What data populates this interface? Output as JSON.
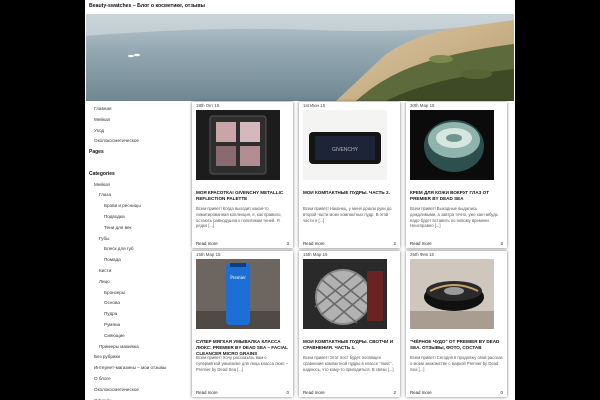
{
  "site": {
    "title": "Beauty-swatches – Блог о косметике, отзывы"
  },
  "sidebar": {
    "items": [
      {
        "label": "Главная",
        "level": 1,
        "heading": false
      },
      {
        "label": "Мейкап",
        "level": 1,
        "heading": false
      },
      {
        "label": "Уход",
        "level": 1,
        "heading": false
      },
      {
        "label": "Околокосметическое",
        "level": 1,
        "heading": false
      },
      {
        "label": "Pages",
        "level": 0,
        "heading": true
      },
      {
        "label": "",
        "level": 0,
        "heading": false
      },
      {
        "label": "Categories",
        "level": 0,
        "heading": true
      },
      {
        "label": "Мейкап",
        "level": 1,
        "heading": false
      },
      {
        "label": "Глаза",
        "level": 2,
        "heading": false
      },
      {
        "label": "Брови и ресницы",
        "level": 3,
        "heading": false
      },
      {
        "label": "Подводка",
        "level": 3,
        "heading": false
      },
      {
        "label": "Тени для век",
        "level": 3,
        "heading": false
      },
      {
        "label": "Губы",
        "level": 2,
        "heading": false
      },
      {
        "label": "Блеск для губ",
        "level": 3,
        "heading": false
      },
      {
        "label": "Помада",
        "level": 3,
        "heading": false
      },
      {
        "label": "Кисти",
        "level": 2,
        "heading": false
      },
      {
        "label": "Лицо",
        "level": 2,
        "heading": false
      },
      {
        "label": "Бронзеры",
        "level": 3,
        "heading": false
      },
      {
        "label": "Основа",
        "level": 3,
        "heading": false
      },
      {
        "label": "Пудра",
        "level": 3,
        "heading": false
      },
      {
        "label": "Румяна",
        "level": 3,
        "heading": false
      },
      {
        "label": "Сияющие",
        "level": 3,
        "heading": false
      },
      {
        "label": "Примеры макияжа",
        "level": 2,
        "heading": false
      },
      {
        "label": "Без рубрики",
        "level": 1,
        "heading": false
      },
      {
        "label": "Интернет-магазины – мои отзывы",
        "level": 1,
        "heading": false
      },
      {
        "label": "О блоге",
        "level": 1,
        "heading": false
      },
      {
        "label": "Околокосметическое",
        "level": 1,
        "heading": false
      },
      {
        "label": "Офлайн",
        "level": 1,
        "heading": false
      }
    ]
  },
  "posts": [
    {
      "date": "18th Окт 15",
      "title": "Моя красотка! Givenchy Metallic Reflection Palette",
      "excerpt": "Всем привет! Когда выходит какая-то лимитированная коллекция, я, как правило, остаюсь равнодушна к политикам теней. Я редко [...]",
      "more": "Read more",
      "comments": "3",
      "thumb": "palette"
    },
    {
      "date": "1st Июн 15",
      "title": "Мои компактные пудры. Часть 2.",
      "excerpt": "Всем привет! Наконец, у меня дошли руки до второй части моих компактных пудр. В этой части я [...]",
      "more": "Read more",
      "comments": "2",
      "thumb": "compact"
    },
    {
      "date": "30th Мар 15",
      "title": "Крем для кожи вокруг глаз от Premier by Dead Sea",
      "excerpt": "Всем привет! Выходные выдались дождливыми, а завтра точно, уже как-нибудь надо будет вставить по новому времени. Неисправно [...]",
      "more": "Read more",
      "comments": "3",
      "thumb": "jar"
    },
    {
      "date": "15th Мар 15",
      "title": "Супер мягкая умывалка класса люкс: Premier by Dead Sea – Facial Cleancer Micro Grains",
      "excerpt": "Всем привет! Хочу рассказать вам о супермягкой умывалке для лица класса люкс – Premier by Dead Sea [...]",
      "more": "Read more",
      "comments": "0",
      "thumb": "tube"
    },
    {
      "date": "15th Мар 15",
      "title": "Мои компактные пудры. Свотчи и сравнения. Часть 1.",
      "excerpt": "Всем привет! Этот пост будет посвящен сравнения компактной пудры в классе \"люкс\", надеюсь, что кому-то пригодиться. В связи [...]",
      "more": "Read more",
      "comments": "2",
      "thumb": "quilted"
    },
    {
      "date": "25th Фев 15",
      "title": "\"Чёрное чудо\" от Premier by Dead Sea. Отзывы, фото, состав",
      "excerpt": "Всем привет! Сегодня в продолжу свой рассказ о моем знакомстве с маркой Premier by Dead Sea [...]",
      "more": "Read more",
      "comments": "0",
      "thumb": "pot"
    }
  ]
}
